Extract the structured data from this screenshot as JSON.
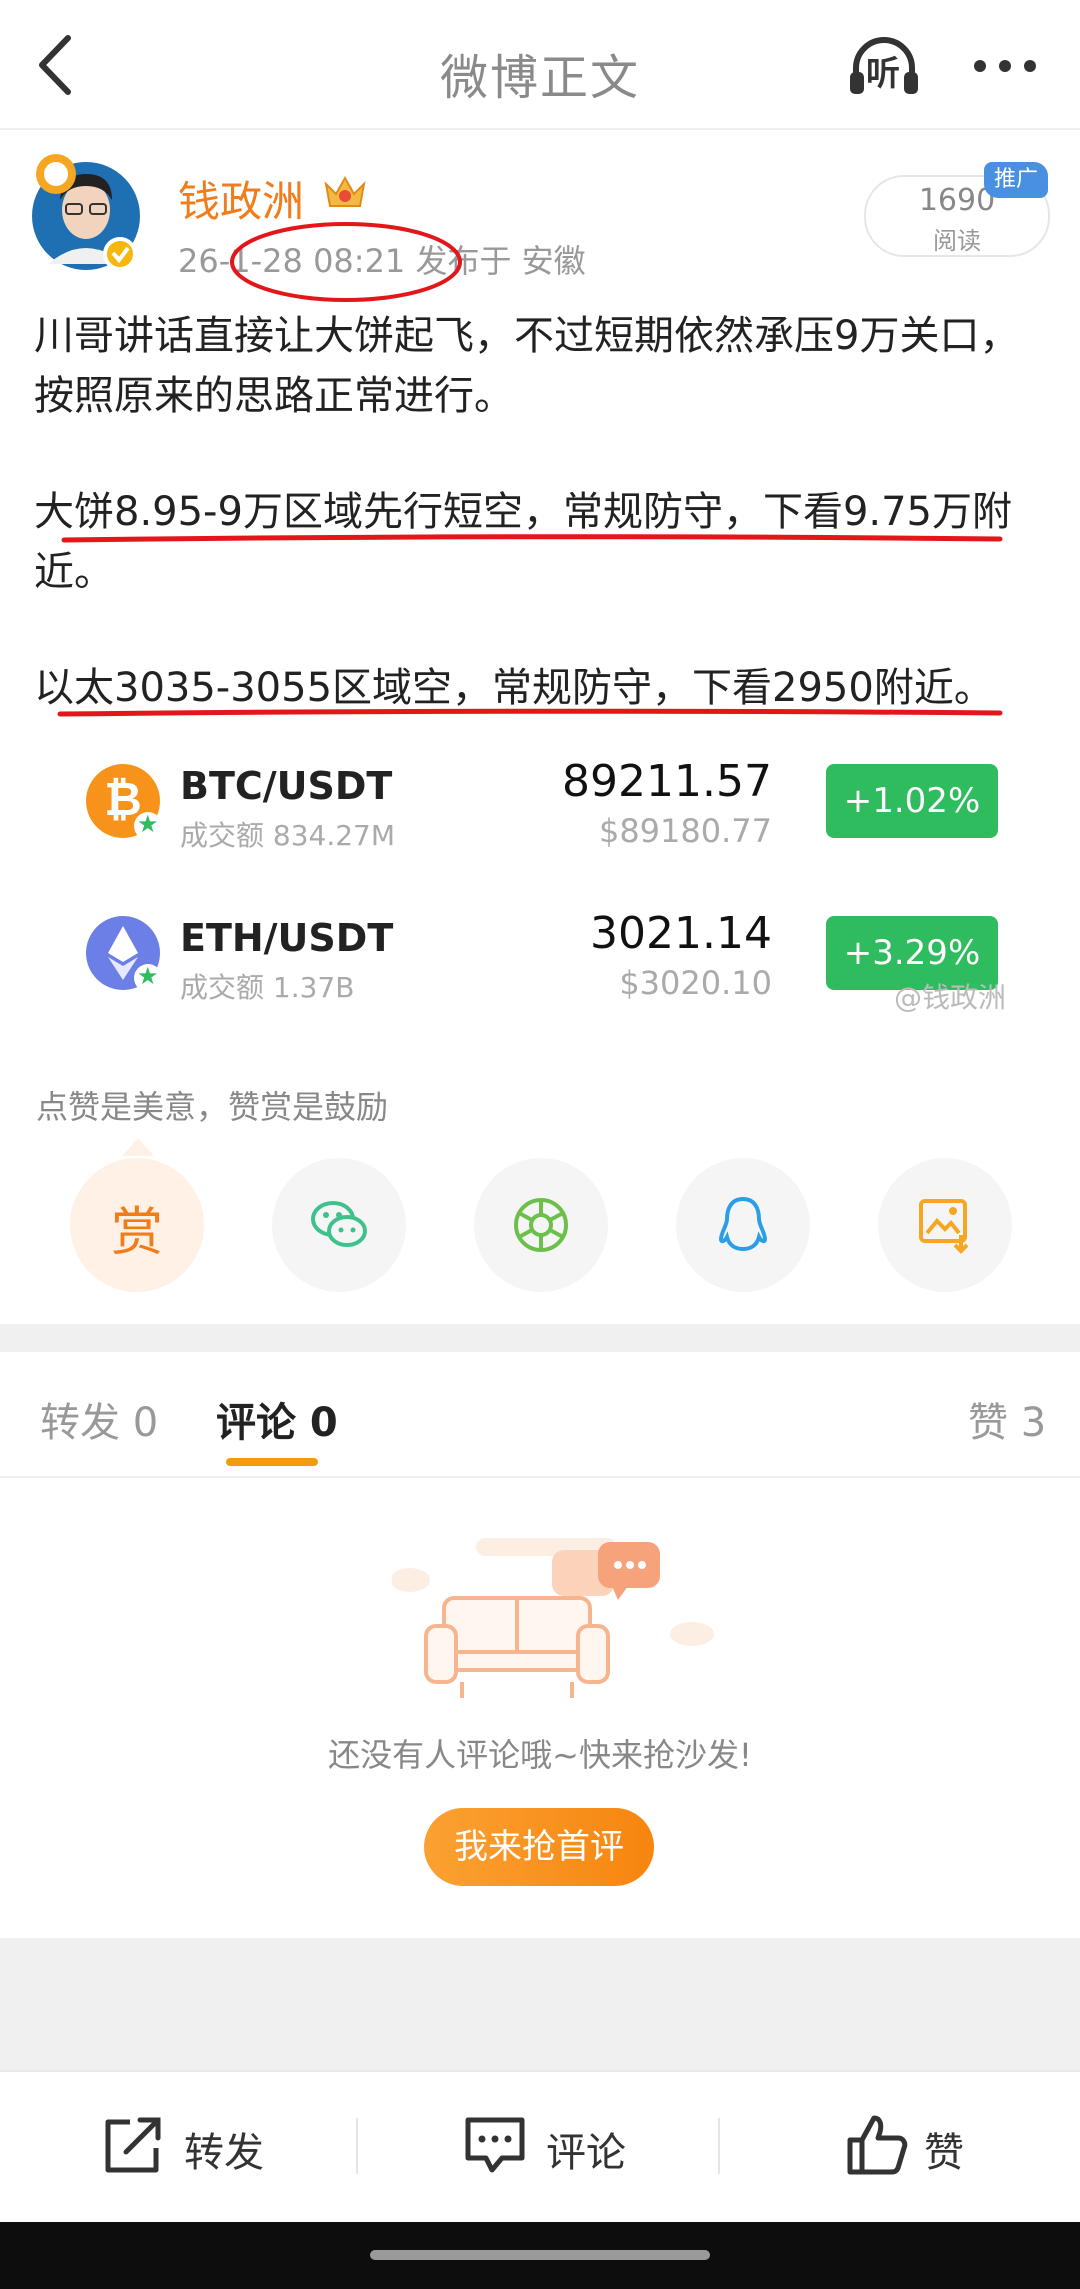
{
  "header": {
    "title": "微博正文",
    "listen_label": "听"
  },
  "author": {
    "name": "钱政洲",
    "meta": "26-1-28 08:21  发布于 安徽",
    "read_count": "1690",
    "read_label": "阅读",
    "promo_badge": "推广"
  },
  "post": {
    "paragraphs": [
      "川哥讲话直接让大饼起飞，不过短期依然承压9万关口，按照原来的思路正常进行。",
      "大饼8.95-9万区域先行短空，常规防守，下看9.75万附近。",
      "以太3035-3055区域空，常规防守，下看2950附近。"
    ],
    "annotation_color": "#e3161a"
  },
  "tickers": [
    {
      "pair": "BTC/USDT",
      "volume": "成交额 834.27M",
      "price": "89211.57",
      "fiat_price": "$89180.77",
      "change": "+1.02%",
      "icon": "bitcoin-icon",
      "icon_color": "#f7931a"
    },
    {
      "pair": "ETH/USDT",
      "volume": "成交额 1.37B",
      "price": "3021.14",
      "fiat_price": "$3020.10",
      "change": "+3.29%",
      "icon": "ethereum-icon",
      "icon_color": "#6c7fe6"
    }
  ],
  "watermark": "@钱政洲",
  "reward": {
    "hint": "点赞是美意，赞赏是鼓励",
    "reward_label": "赏"
  },
  "share_icons": [
    "reward",
    "wechat-icon",
    "moments-icon",
    "qq-icon",
    "save-image-icon"
  ],
  "tabs": {
    "repost": "转发 0",
    "comments": "评论 0",
    "likes": "赞 3"
  },
  "empty_state": {
    "message": "还没有人评论哦~快来抢沙发!",
    "cta": "我来抢首评"
  },
  "bottom_bar": {
    "repost": "转发",
    "comment": "评论",
    "like": "赞"
  },
  "colors": {
    "accent": "#f07c1a",
    "positive": "#2ebc5f",
    "cta": "#f7850f"
  }
}
